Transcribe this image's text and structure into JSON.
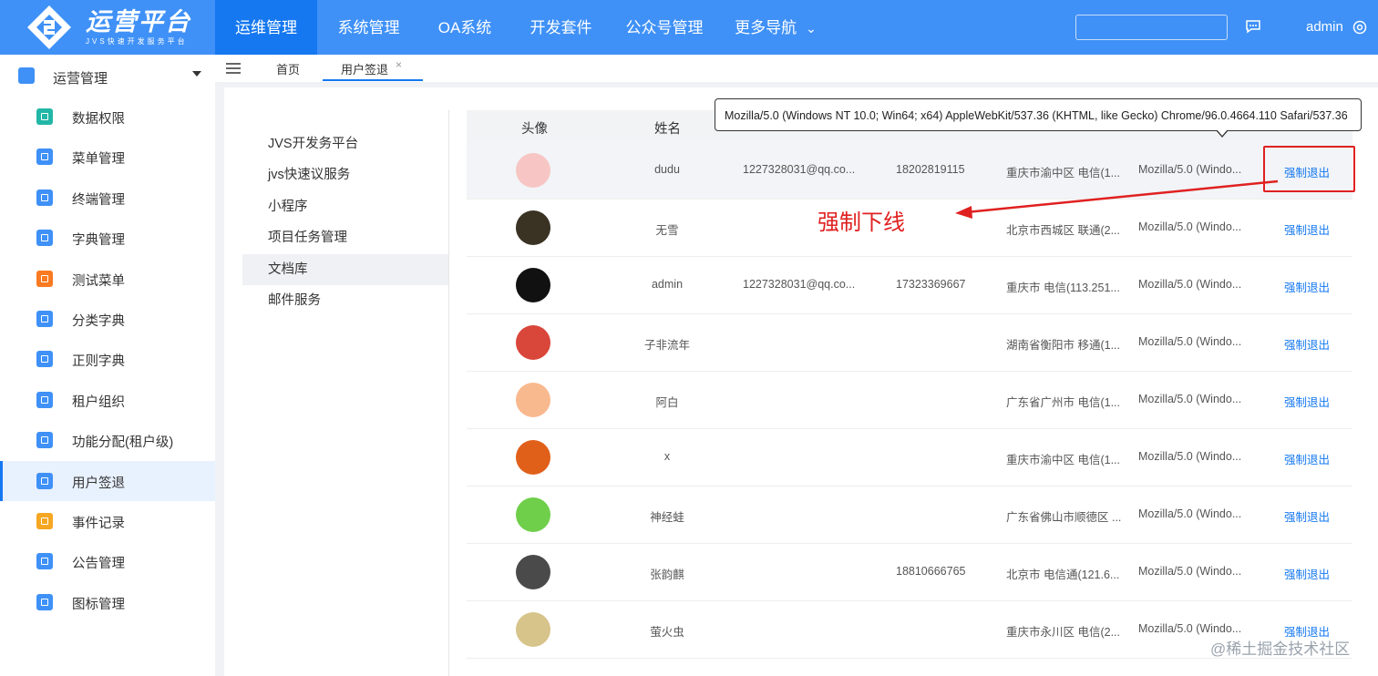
{
  "app": {
    "logo_title": "运营平台",
    "logo_subtitle": "JVS快速开发服务平台"
  },
  "topnav": {
    "items": [
      {
        "label": "运维管理",
        "active": true
      },
      {
        "label": "系统管理",
        "active": false
      },
      {
        "label": "OA系统",
        "active": false
      },
      {
        "label": "开发套件",
        "active": false
      },
      {
        "label": "公众号管理",
        "active": false
      },
      {
        "label": "更多导航",
        "active": false
      }
    ],
    "search_value": "",
    "user": "admin"
  },
  "sidebar": {
    "header": "运营管理",
    "items": [
      {
        "label": "数据权限",
        "color": "#22b7a7"
      },
      {
        "label": "菜单管理",
        "color": "#3f91f7"
      },
      {
        "label": "终端管理",
        "color": "#3f91f7"
      },
      {
        "label": "字典管理",
        "color": "#3f91f7"
      },
      {
        "label": "测试菜单",
        "color": "#f97a20"
      },
      {
        "label": "分类字典",
        "color": "#3f91f7"
      },
      {
        "label": "正则字典",
        "color": "#3f91f7"
      },
      {
        "label": "租户组织",
        "color": "#3f91f7"
      },
      {
        "label": "功能分配(租户级)",
        "color": "#3f91f7"
      },
      {
        "label": "用户签退",
        "color": "#3f91f7",
        "active": true
      },
      {
        "label": "事件记录",
        "color": "#f5a623"
      },
      {
        "label": "公告管理",
        "color": "#3f91f7"
      },
      {
        "label": "图标管理",
        "color": "#3f91f7"
      }
    ]
  },
  "tabs": {
    "home": "首页",
    "current": "用户签退",
    "close": "×"
  },
  "sublist": {
    "items": [
      {
        "label": "JVS开发务平台"
      },
      {
        "label": "jvs快速议服务"
      },
      {
        "label": "小程序"
      },
      {
        "label": "项目任务管理"
      },
      {
        "label": "文档库",
        "active": true
      },
      {
        "label": "邮件服务"
      }
    ]
  },
  "table": {
    "headers": {
      "avatar": "头像",
      "name": "姓名"
    },
    "rows": [
      {
        "name": "dudu",
        "email": "1227328031@qq.co...",
        "phone": "18202819115",
        "ip": "重庆市渝中区 电信(1...",
        "ua": "Mozilla/5.0 (Windo...",
        "op": "强制退出",
        "avatar_color": "#f7c6c4"
      },
      {
        "name": "无雪",
        "email": "",
        "phone": "",
        "ip": "北京市西城区 联通(2...",
        "ua": "Mozilla/5.0 (Windo...",
        "op": "强制退出",
        "avatar_color": "#3a3324"
      },
      {
        "name": "admin",
        "email": "1227328031@qq.co...",
        "phone": "17323369667",
        "ip": "重庆市 电信(113.251...",
        "ua": "Mozilla/5.0 (Windo...",
        "op": "强制退出",
        "avatar_color": "#111111"
      },
      {
        "name": "子非流年",
        "email": "",
        "phone": "",
        "ip": "湖南省衡阳市 移通(1...",
        "ua": "Mozilla/5.0 (Windo...",
        "op": "强制退出",
        "avatar_color": "#d9463a"
      },
      {
        "name": "阿白",
        "email": "",
        "phone": "",
        "ip": "广东省广州市 电信(1...",
        "ua": "Mozilla/5.0 (Windo...",
        "op": "强制退出",
        "avatar_color": "#f9b98e"
      },
      {
        "name": "x",
        "email": "",
        "phone": "",
        "ip": "重庆市渝中区 电信(1...",
        "ua": "Mozilla/5.0 (Windo...",
        "op": "强制退出",
        "avatar_color": "#e0601a"
      },
      {
        "name": "神经蛙",
        "email": "",
        "phone": "",
        "ip": "广东省佛山市顺德区 ...",
        "ua": "Mozilla/5.0 (Windo...",
        "op": "强制退出",
        "avatar_color": "#6fcf4a"
      },
      {
        "name": "张韵麒",
        "email": "",
        "phone": "18810666765",
        "ip": "北京市 电信通(121.6...",
        "ua": "Mozilla/5.0 (Windo...",
        "op": "强制退出",
        "avatar_color": "#4a4a4a"
      },
      {
        "name": "萤火虫",
        "email": "",
        "phone": "",
        "ip": "重庆市永川区 电信(2...",
        "ua": "Mozilla/5.0 (Windo...",
        "op": "强制退出",
        "avatar_color": "#d7c48a"
      }
    ]
  },
  "tooltip": {
    "text": "Mozilla/5.0 (Windows NT 10.0; Win64; x64) AppleWebKit/537.36 (KHTML, like Gecko) Chrome/96.0.4664.110 Safari/537.36"
  },
  "annotation": {
    "text": "强制下线",
    "color": "#e02020"
  },
  "watermark": "@稀土掘金技术社区",
  "colors": {
    "brand": "#3f91f7",
    "brand_dark": "#1578f0"
  }
}
